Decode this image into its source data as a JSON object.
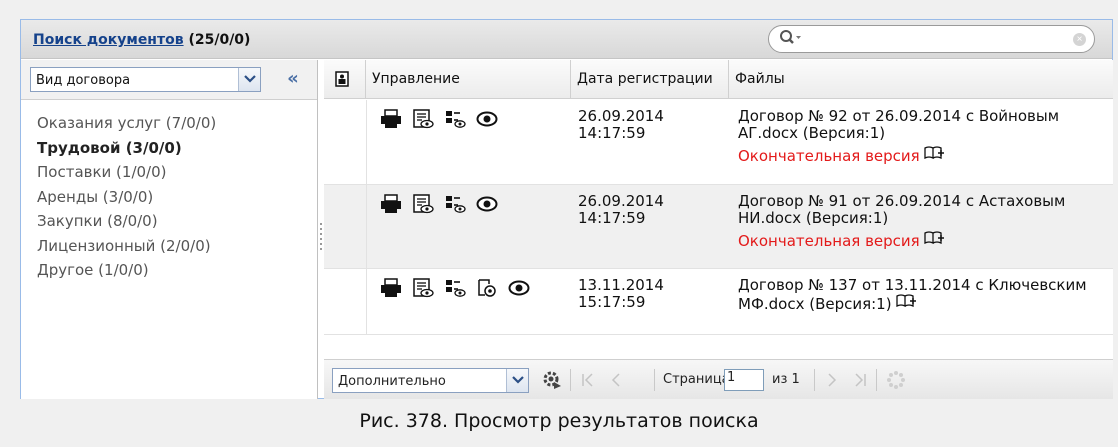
{
  "header": {
    "title_link": "Поиск документов",
    "title_count": " (25/0/0)",
    "search_placeholder": ""
  },
  "sidebar": {
    "select_value": "Вид договора",
    "collapse_label": "«",
    "items": [
      {
        "label": "Оказания услуг (7/0/0)"
      },
      {
        "label": "Трудовой (3/0/0)"
      },
      {
        "label": "Поставки (1/0/0)"
      },
      {
        "label": "Аренды (3/0/0)"
      },
      {
        "label": "Закупки (8/0/0)"
      },
      {
        "label": "Лицензионный (2/0/0)"
      },
      {
        "label": "Другое (1/0/0)"
      }
    ]
  },
  "grid": {
    "columns": {
      "manage": "Управление",
      "date": "Дата регистрации",
      "files": "Файлы"
    },
    "rows": [
      {
        "date": "26.09.2014\n14:17:59",
        "file": "Договор № 92 от 26.09.2014 с Войновым АГ.docx (Версия:1)",
        "status": "Окончательная версия"
      },
      {
        "date": "26.09.2014\n14:17:59",
        "file": "Договор № 91 от 26.09.2014 с Астаховым НИ.docx (Версия:1)",
        "status": "Окончательная версия"
      },
      {
        "date": "13.11.2014\n15:17:59",
        "file": "Договор № 137 от 13.11.2014 с Ключевским МФ.docx (Версия:1)",
        "status": ""
      }
    ]
  },
  "paging": {
    "more_value": "Дополнительно",
    "page_label": "Страница",
    "page_value": "1",
    "page_of": "из 1"
  },
  "caption": "Рис. 378. Просмотр результатов поиска",
  "colors": {
    "link": "#15428b",
    "final_status": "#e31a1a",
    "alt_row": "#f0f0f0"
  }
}
